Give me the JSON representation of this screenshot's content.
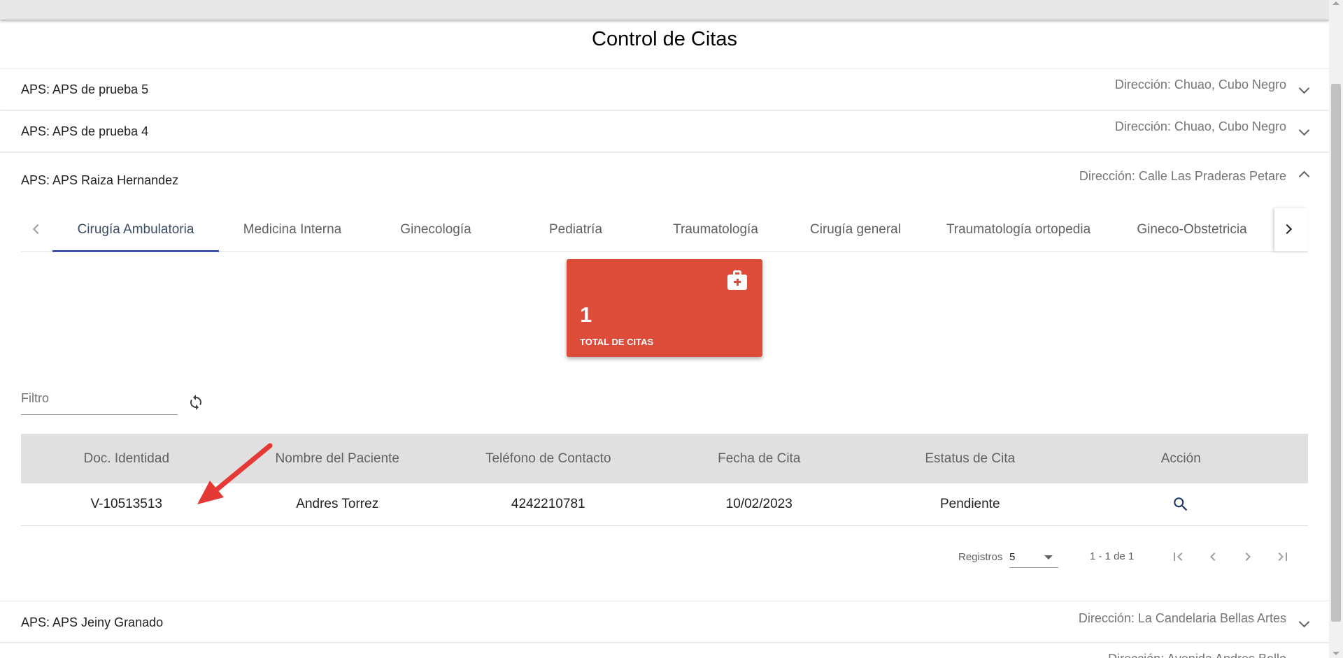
{
  "page": {
    "title": "Control de Citas"
  },
  "panels": [
    {
      "title": "APS: APS de prueba 5",
      "description": "Dirección: Chuao, Cubo Negro",
      "expanded": false
    },
    {
      "title": "APS: APS de prueba 4",
      "description": "Dirección: Chuao, Cubo Negro",
      "expanded": false
    },
    {
      "title": "APS: APS Raiza Hernandez",
      "description": "Dirección: Calle Las Praderas Petare",
      "expanded": true
    },
    {
      "title": "APS: APS Jeiny Granado",
      "description": "Dirección: La Candelaria Bellas Artes",
      "expanded": false
    },
    {
      "title": "",
      "description": "Dirección: Avenida Andres Bello",
      "expanded": false
    }
  ],
  "tabs": {
    "items": [
      {
        "label": "Cirugía Ambulatoria",
        "active": true
      },
      {
        "label": "Medicina Interna",
        "active": false
      },
      {
        "label": "Ginecología",
        "active": false
      },
      {
        "label": "Pediatría",
        "active": false
      },
      {
        "label": "Traumatología",
        "active": false
      },
      {
        "label": "Cirugía general",
        "active": false
      },
      {
        "label": "Traumatología ortopedia",
        "active": false
      },
      {
        "label": "Gineco-Obstetricia",
        "active": false
      }
    ]
  },
  "stat_card": {
    "value": "1",
    "label": "TOTAL DE CITAS",
    "icon": "medical-kit-icon",
    "color": "#dd4b39"
  },
  "filter": {
    "placeholder": "Filtro",
    "value": ""
  },
  "table": {
    "headers": [
      "Doc. Identidad",
      "Nombre del Paciente",
      "Teléfono de Contacto",
      "Fecha de Cita",
      "Estatus de Cita",
      "Acción"
    ],
    "rows": [
      {
        "doc": "V-10513513",
        "name": "Andres Torrez",
        "phone": "4242210781",
        "date": "10/02/2023",
        "status": "Pendiente",
        "action_icon": "search-icon"
      }
    ]
  },
  "paginator": {
    "label": "Registros",
    "page_size": "5",
    "range": "1 - 1 de 1"
  },
  "colors": {
    "accent": "#3f51b5",
    "card": "#dd4b39",
    "annotation_arrow": "#e53935"
  }
}
